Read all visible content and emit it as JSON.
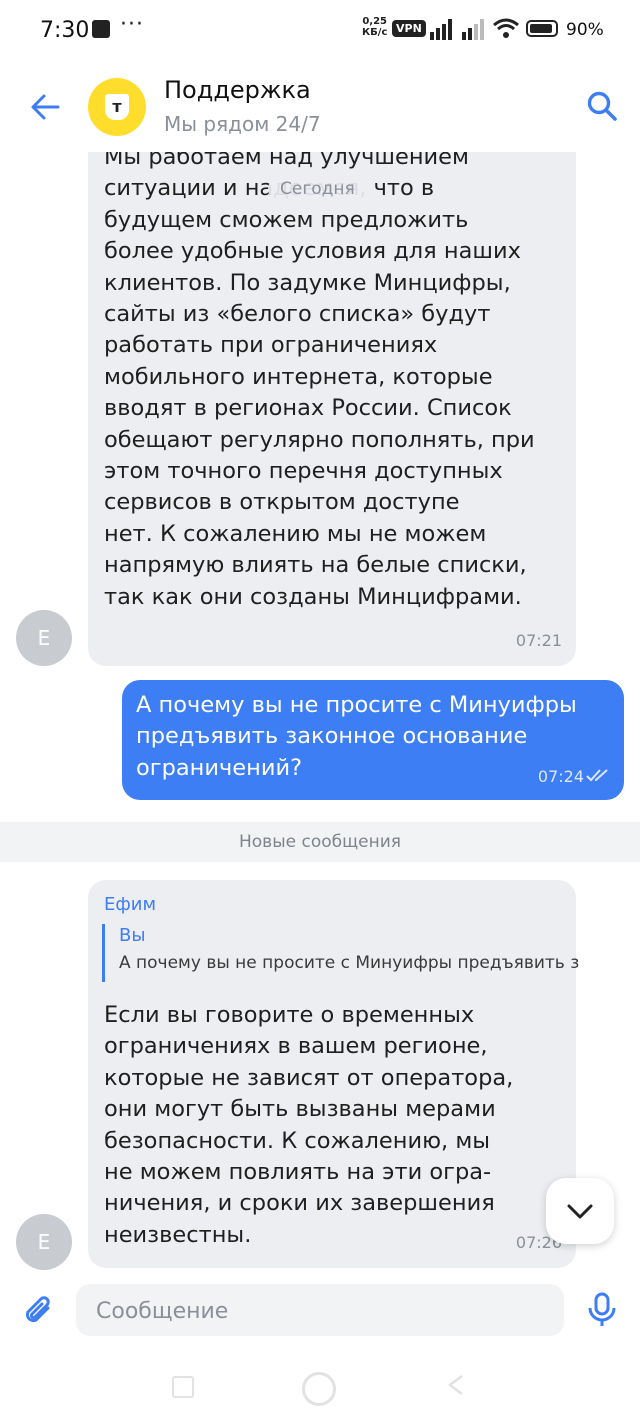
{
  "status_bar": {
    "time": "7:30",
    "speed": "0,25\nКБ/с",
    "vpn": "VPN",
    "battery": "90%"
  },
  "header": {
    "title": "Поддержка",
    "subtitle": "Мы рядом 24/7",
    "logo_letter": "т"
  },
  "date_pill": "Сегодня",
  "messages": {
    "m1": {
      "avatar_letter": "Е",
      "text": "Мы работаем над улучшением\nситуации и надеемся, что в\nбудущем сможем предложить\nболее удобные условия для наших\nклиентов. По задумке Минцифры,\nсайты из «белого списка» будут\nработать при ограничениях\nмобильного интернета, которые\nвводят в регионах России. Список\nобещают регулярно пополнять, при\nэтом точного перечня доступных\nсервисов в открытом доступе\nнет. К сожалению мы не можем\nнапрямую влиять на белые списки,\nтак как они созданы Минцифрами.",
      "time": "07:21"
    },
    "m2": {
      "text": "А почему вы не просите с Минуифры\nпредъявить законное основание\nограничений?",
      "time": "07:24"
    },
    "m3": {
      "avatar_letter": "Е",
      "sender": "Ефим",
      "quote_name": "Вы",
      "quote_text": "А почему вы не просите с Минуифры предъявить законное основание ограничений?",
      "text": "Если вы говорите о временных\nограничениях в вашем регионе,\nкоторые не зависят от оператора,\nони могут быть вызваны мерами\nбезопасности. К сожалению, мы\nне можем повлиять на эти огра-\nничения, и сроки их завершения\nнеизвестны.",
      "time": "07:26"
    }
  },
  "new_messages_label": "Новые сообщения",
  "input": {
    "placeholder": "Сообщение",
    "value": ""
  },
  "colors": {
    "accent": "#3d7ef4",
    "incoming_bubble": "#eceef2",
    "brand_yellow": "#ffdd2d"
  }
}
